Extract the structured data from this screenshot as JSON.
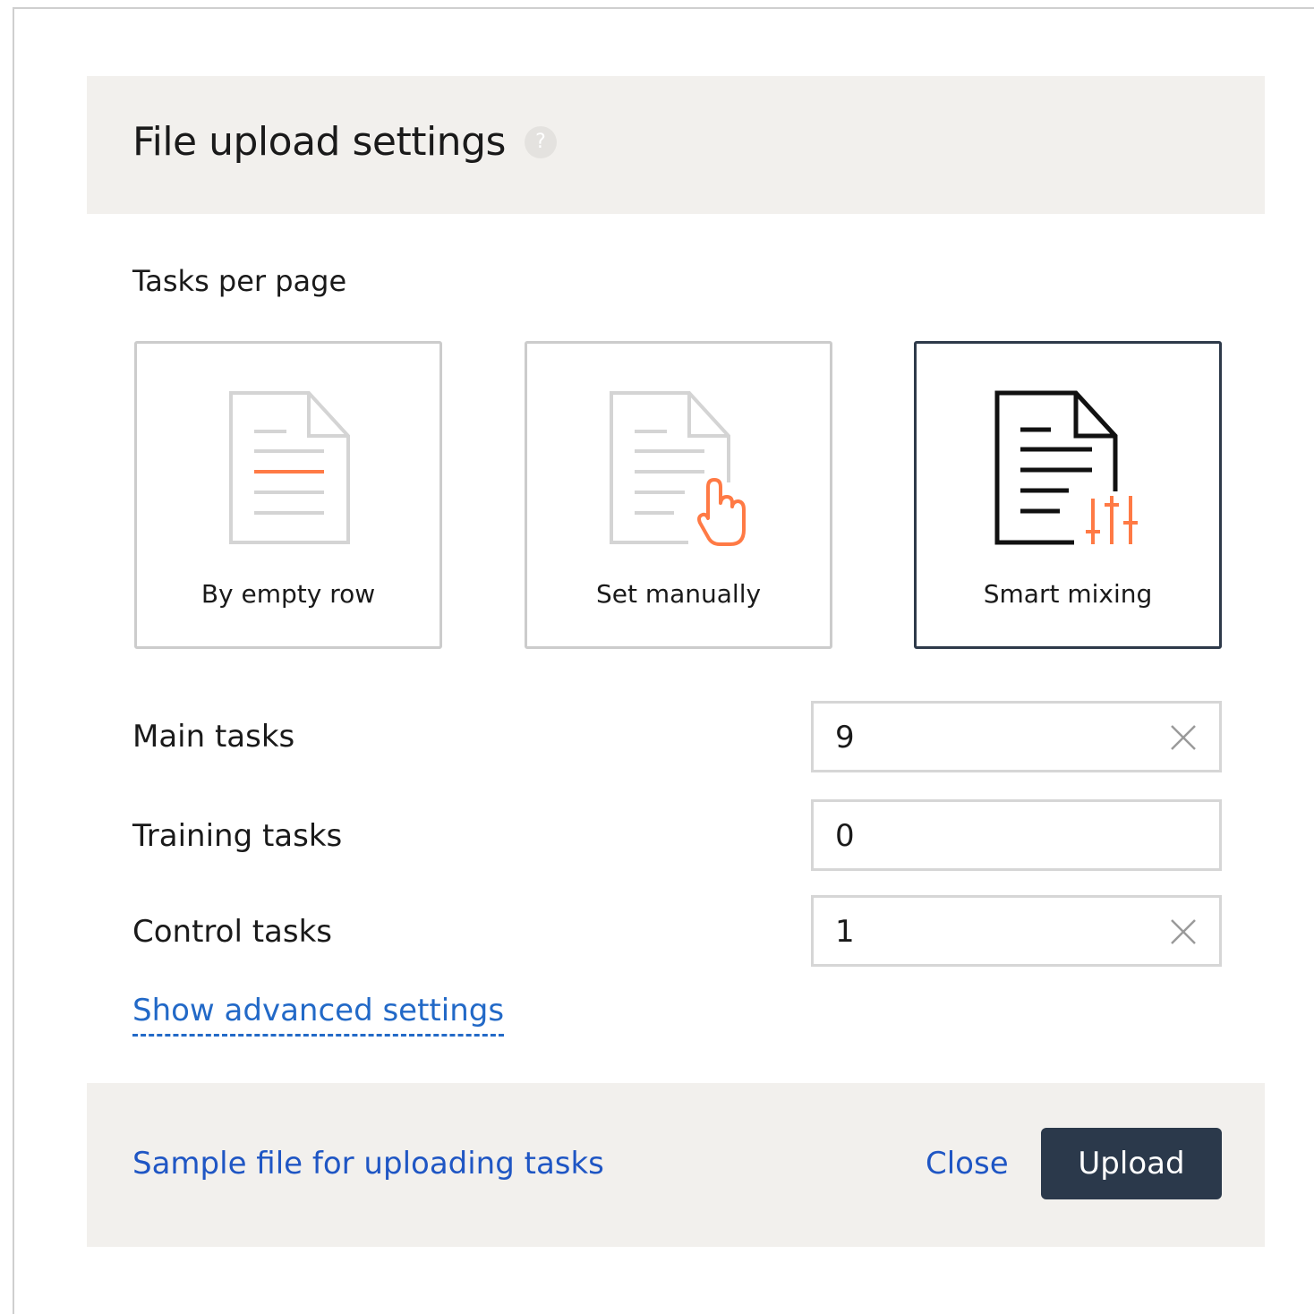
{
  "dialog": {
    "title": "File upload settings",
    "help_icon": "?"
  },
  "tasks_per_page": {
    "label": "Tasks per page",
    "options": [
      {
        "label": "By empty row",
        "icon": "document-empty-row-icon",
        "selected": false
      },
      {
        "label": "Set manually",
        "icon": "document-hand-pointer-icon",
        "selected": false
      },
      {
        "label": "Smart mixing",
        "icon": "document-sliders-icon",
        "selected": true
      }
    ]
  },
  "fields": {
    "main_tasks": {
      "label": "Main tasks",
      "value": "9"
    },
    "training_tasks": {
      "label": "Training tasks",
      "value": "0"
    },
    "control_tasks": {
      "label": "Control tasks",
      "value": "1"
    }
  },
  "advanced_link": "Show advanced settings",
  "footer": {
    "sample_link": "Sample file for uploading tasks",
    "close_label": "Close",
    "upload_label": "Upload"
  },
  "colors": {
    "accent_orange": "#ff7a45",
    "link_blue": "#1f56c4",
    "primary_button": "#2b394b",
    "panel_bg": "#f2f0ed"
  }
}
